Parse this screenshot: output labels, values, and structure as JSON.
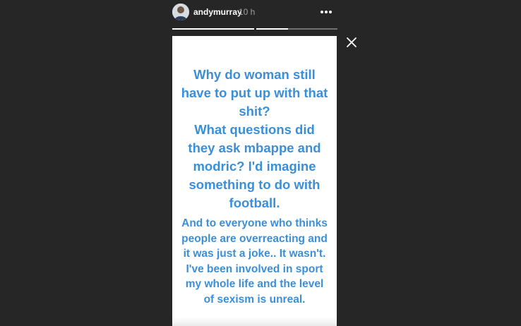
{
  "header": {
    "username": "andymurray",
    "timestamp": "10 h"
  },
  "progress": {
    "segments": [
      1.0,
      0.39
    ]
  },
  "story": {
    "para1_lines": [
      "Why do woman still",
      "have to put up with that",
      "shit?",
      "What questions did",
      "they ask mbappe and",
      "modric? I'd imagine",
      "something to do with",
      "football."
    ],
    "para2_lines": [
      "And to everyone who thinks",
      "people are overreacting and",
      "it was just a joke.. It wasn't.",
      "I've been involved in sport",
      "my whole life and the level",
      "of sexism is unreal."
    ]
  },
  "colors": {
    "background": "#262626",
    "story_text": "#3b8fd8",
    "card": "#ffffff"
  },
  "icons": {
    "more": "more-horizontal-icon",
    "close": "close-icon",
    "avatar": "avatar"
  }
}
